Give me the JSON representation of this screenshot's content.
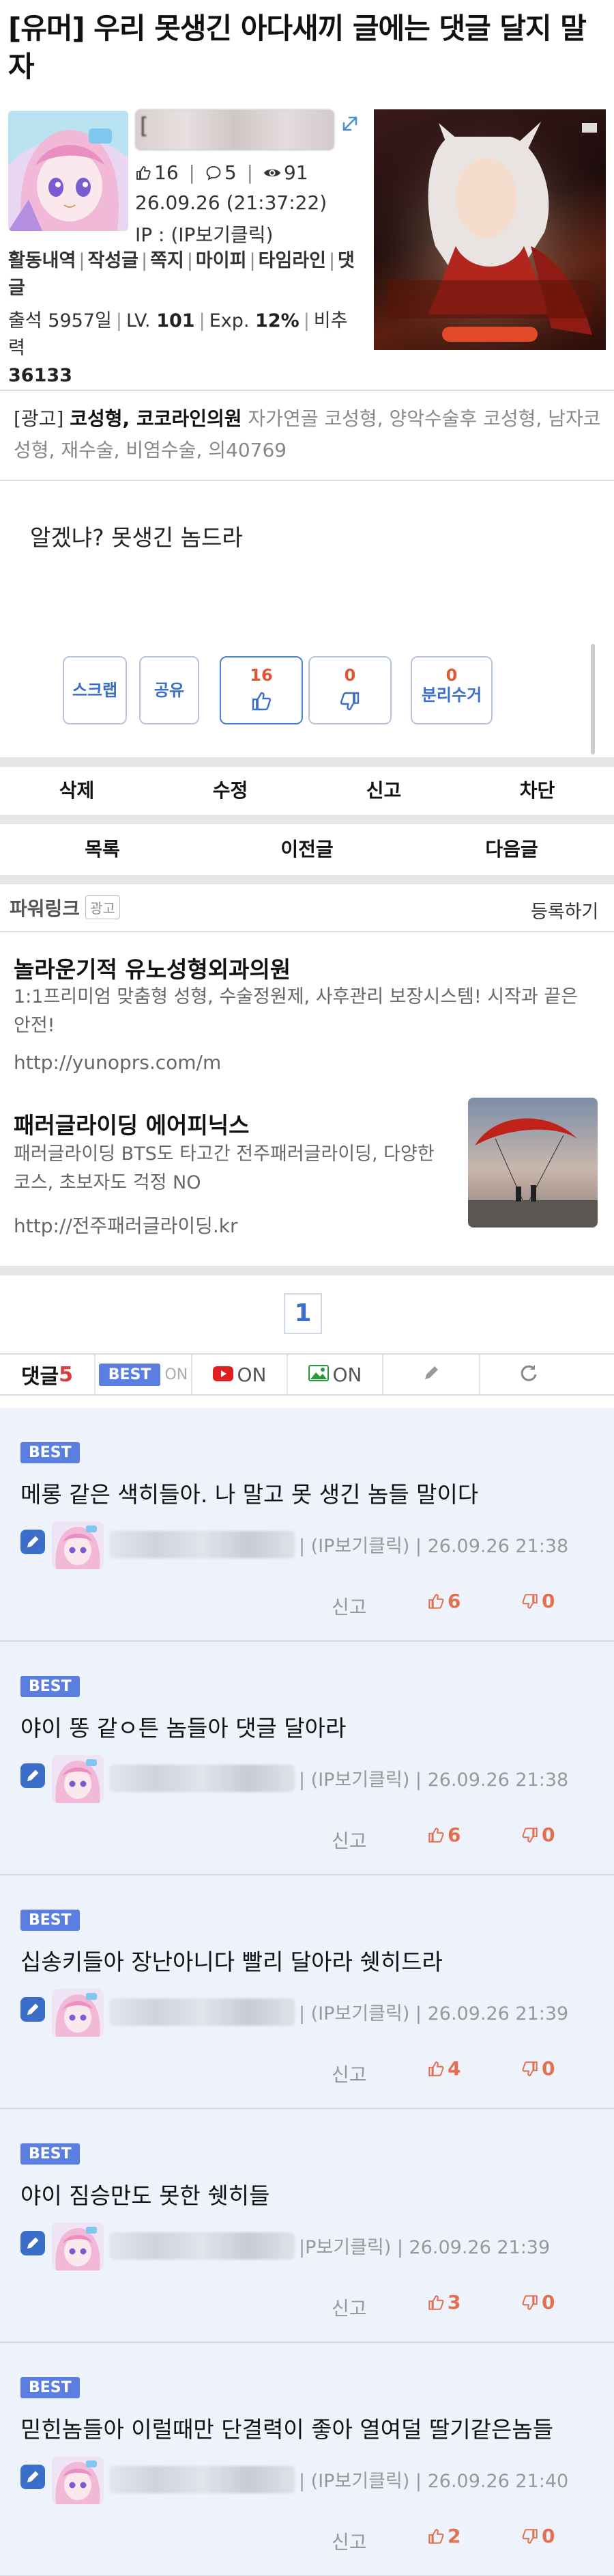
{
  "post": {
    "title": "[유머] 우리 못생긴 아다새끼 글에는 댓글 달지 말자",
    "author_masked": "[",
    "upvotes_header": "16",
    "comments_header": "5",
    "views": "91",
    "datetime": "26.09.26 (21:37:22)",
    "ip": "IP : (IP보기클릭)",
    "body": "알겠냐? 못생긴 놈드라"
  },
  "author_links": [
    "활동내역",
    "작성글",
    "쪽지",
    "마이피",
    "타임라인",
    "댓글"
  ],
  "author_stats": {
    "attend_label": "출석",
    "attend_value": "5957일",
    "level_label": "LV.",
    "level_value": "101",
    "exp_label": "Exp.",
    "exp_value": "12%",
    "nonreflect_label": "비추력",
    "nonreflect_value": "36133"
  },
  "banner_ad": {
    "icon_color": "#b8322a"
  },
  "ad_text": {
    "tag": "[광고]",
    "bold": "코성형, 코코라인의원",
    "rest": "자가연골 코성형, 양악수술후 코성형, 남자코성형, 재수술, 비염수술, 의40769"
  },
  "vote_buttons": {
    "scrap": "스크랩",
    "share": "공유",
    "up_count": "16",
    "down_count": "0",
    "report_count": "0",
    "report_label": "분리수거"
  },
  "actions_row1": [
    "삭제",
    "수정",
    "신고",
    "차단"
  ],
  "actions_row2": [
    "목록",
    "이전글",
    "다음글"
  ],
  "powerlink": {
    "title": "파워링크",
    "badge": "광고",
    "register": "등록하기",
    "ads": [
      {
        "title": "놀라운기적 유노성형외과의원",
        "desc": "1:1프리미엄 맞춤형 성형, 수술정원제, 사후관리 보장시스템! 시작과 끝은 안전!",
        "url": "http://yunoprs.com/m"
      },
      {
        "title": "패러글라이딩 에어피닉스",
        "desc": "패러글라이딩 BTS도 타고간 전주패러글라이딩, 다양한코스, 초보자도 걱정 NO",
        "url": "http://전주패러글라이딩.kr"
      }
    ]
  },
  "pagination": {
    "current": "1"
  },
  "comment_toolbar": {
    "label": "댓글",
    "count": "5",
    "best": "BEST",
    "best_state": "ON",
    "youtube_state": "ON",
    "image_state": "ON"
  },
  "comments": [
    {
      "best": "BEST",
      "text": "메롱 같은 색히들아. 나 말고 못 생긴 놈들 말이다",
      "meta": "| (IP보기클릭) | 26.09.26 21:38",
      "report": "신고",
      "up": "6",
      "down": "0"
    },
    {
      "best": "BEST",
      "text": "야이 똥 같ㅇ튼 놈들아 댓글 달아라",
      "meta": "| (IP보기클릭) | 26.09.26 21:38",
      "report": "신고",
      "up": "6",
      "down": "0"
    },
    {
      "best": "BEST",
      "text": "십송키들아 장난아니다 빨리 달아라 쉣히드라",
      "meta": "| (IP보기클릭) | 26.09.26 21:39",
      "report": "신고",
      "up": "4",
      "down": "0"
    },
    {
      "best": "BEST",
      "text": "야이 짐승만도 못한 쉣히들",
      "meta": "|P보기클릭) | 26.09.26 21:39",
      "report": "신고",
      "up": "3",
      "down": "0"
    },
    {
      "best": "BEST",
      "text": "믿힌놈들아 이럴때만 단결력이 좋아 열여덜 딸기같은놈들",
      "meta": "| (IP보기클릭) | 26.09.26 21:40",
      "report": "신고",
      "up": "2",
      "down": "0"
    }
  ]
}
